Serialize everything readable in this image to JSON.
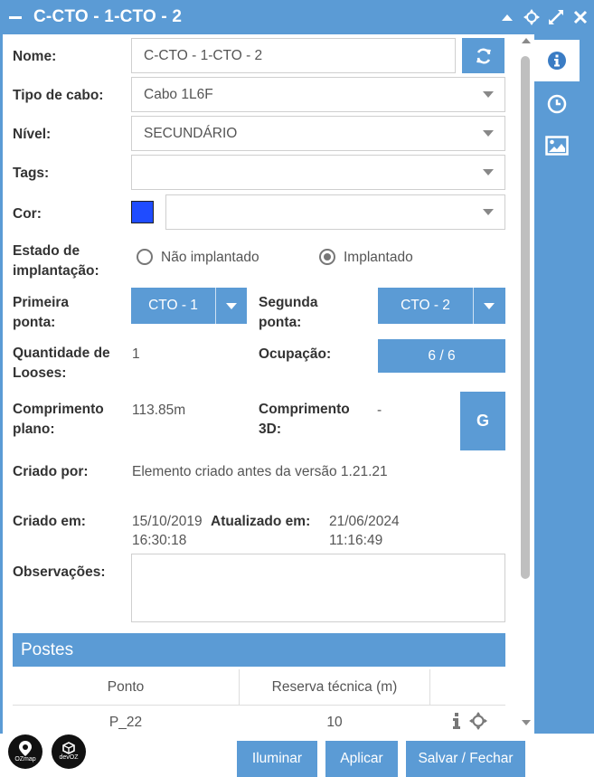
{
  "window": {
    "title": "C-CTO - 1-CTO - 2"
  },
  "form": {
    "nome": {
      "label": "Nome:",
      "value": "C-CTO - 1-CTO - 2"
    },
    "tipo_cabo": {
      "label": "Tipo de cabo:",
      "value": "Cabo 1L6F"
    },
    "nivel": {
      "label": "Nível:",
      "value": "SECUNDÁRIO"
    },
    "tags": {
      "label": "Tags:",
      "value": ""
    },
    "cor": {
      "label": "Cor:",
      "swatch": "#1f4cff",
      "value": ""
    },
    "estado": {
      "label_line1": "Estado de",
      "label_line2": "implantação:",
      "options": [
        {
          "label": "Não implantado",
          "selected": false
        },
        {
          "label": "Implantado",
          "selected": true
        }
      ]
    },
    "primeira_ponta": {
      "label_line1": "Primeira",
      "label_line2": "ponta:",
      "value": "CTO - 1"
    },
    "segunda_ponta": {
      "label_line1": "Segunda",
      "label_line2": "ponta:",
      "value": "CTO - 2"
    },
    "quantidade_looses": {
      "label_line1": "Quantidade de",
      "label_line2": "Looses:",
      "value": "1"
    },
    "ocupacao": {
      "label": "Ocupação:",
      "value": "6 / 6"
    },
    "comprimento_plano": {
      "label_line1": "Comprimento",
      "label_line2": "plano:",
      "value": "113.85m"
    },
    "comprimento_3d": {
      "label_line1": "Comprimento",
      "label_line2": "3D:",
      "value": "-"
    },
    "g_button": "G",
    "criado_por": {
      "label": "Criado por:",
      "value": "Elemento criado antes da versão 1.21.21"
    },
    "criado_em": {
      "label": "Criado em:",
      "date": "15/10/2019",
      "time": "16:30:18"
    },
    "atualizado_em": {
      "label": "Atualizado em:",
      "date": "21/06/2024",
      "time": "11:16:49"
    },
    "observacoes": {
      "label": "Observações:",
      "value": ""
    }
  },
  "postes": {
    "title": "Postes",
    "columns": [
      "Ponto",
      "Reserva técnica (m)"
    ],
    "rows": [
      {
        "ponto": "P_22",
        "reserva": "10"
      }
    ]
  },
  "footer": {
    "logo1": "OZmap",
    "logo2": "devOZ",
    "buttons": [
      "Iluminar",
      "Aplicar",
      "Salvar / Fechar"
    ]
  },
  "colors": {
    "accent": "#5b9bd5",
    "swatch": "#1f4cff"
  }
}
